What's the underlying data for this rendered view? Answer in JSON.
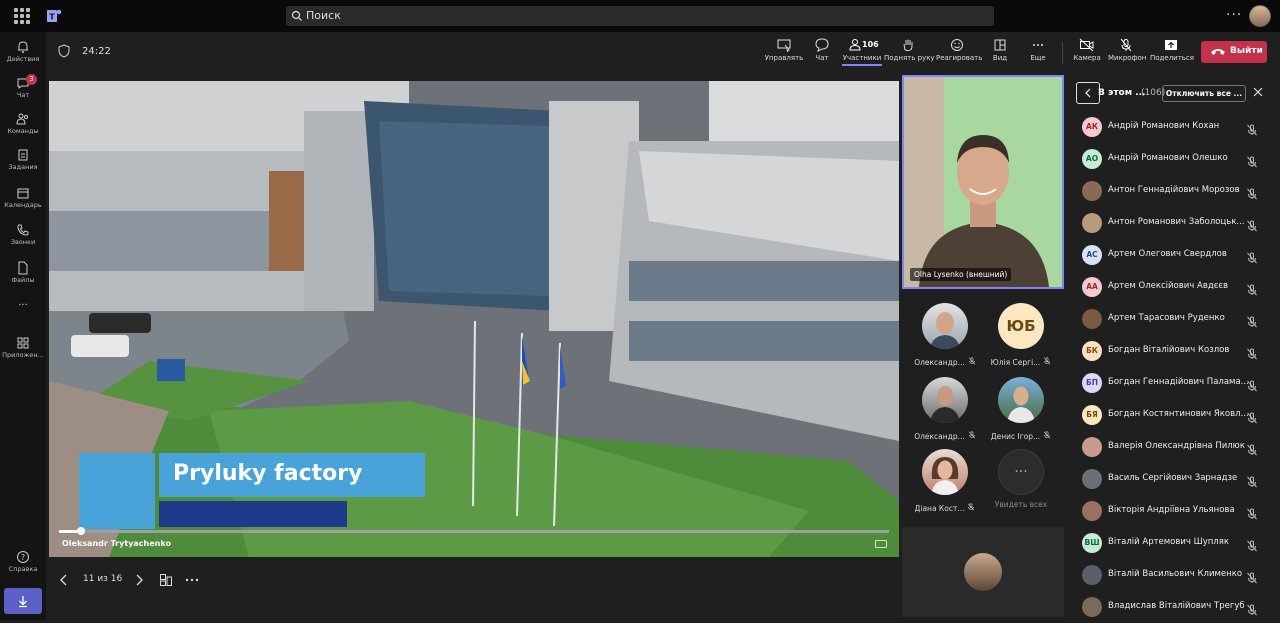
{
  "topbar": {
    "search_placeholder": "Поиск",
    "more": "···"
  },
  "rail": [
    {
      "label": "Действия",
      "icon": "bell-icon"
    },
    {
      "label": "Чат",
      "icon": "chat-icon",
      "badge": "3"
    },
    {
      "label": "Команды",
      "icon": "teams-icon"
    },
    {
      "label": "Задания",
      "icon": "assignments-icon"
    },
    {
      "label": "Календарь",
      "icon": "calendar-icon"
    },
    {
      "label": "Звонки",
      "icon": "phone-icon"
    },
    {
      "label": "Файлы",
      "icon": "file-icon"
    },
    {
      "label": "···",
      "icon": "more-icon"
    },
    {
      "label": "Приложен...",
      "icon": "apps-icon"
    },
    {
      "label": "Справка",
      "icon": "help-icon"
    }
  ],
  "meeting": {
    "timer": "24:22",
    "controls": [
      {
        "label": "Управлять",
        "icon": "share-control-icon"
      },
      {
        "label": "Чат",
        "icon": "chat-icon"
      },
      {
        "label": "Участники",
        "icon": "people-icon",
        "count": "106",
        "active": true
      },
      {
        "label": "Поднять руку",
        "icon": "hand-icon"
      },
      {
        "label": "Реагировать",
        "icon": "smile-icon"
      },
      {
        "label": "Вид",
        "icon": "layout-icon"
      },
      {
        "label": "Еще",
        "icon": "more-icon"
      },
      {
        "label": "Камера",
        "icon": "camera-off-icon"
      },
      {
        "label": "Микрофон",
        "icon": "mic-off-icon"
      },
      {
        "label": "Поделиться",
        "icon": "share-icon"
      }
    ],
    "leave_label": "Выйти"
  },
  "stage": {
    "caption_title": "Pryluky factory",
    "presenter_name": "Oleksandr Trytyachenko",
    "progress_fraction": 0.026,
    "slide_counter": "11 из 16"
  },
  "speaker": {
    "name": "Olha Lysenko (внешний)"
  },
  "tiles": [
    {
      "name": "Олександр...",
      "type": "photo",
      "muted": true
    },
    {
      "name": "Юлія Сергі...",
      "type": "initials",
      "initials": "ЮБ",
      "muted": true
    },
    {
      "name": "Олександр...",
      "type": "photo",
      "muted": true
    },
    {
      "name": "Денис Ігор...",
      "type": "photo",
      "muted": true
    },
    {
      "name": "Діана Кост...",
      "type": "photo",
      "muted": true
    },
    {
      "name": "Увидеть всех",
      "type": "more",
      "muted": false
    }
  ],
  "panel": {
    "title": "В этом ...",
    "count": "(106)",
    "mute_all_label": "Отключить все ...",
    "participants": [
      {
        "name": "Андрій Романович Кохан",
        "initials": "АК",
        "bg": "#f4c9d0",
        "fg": "#a4262c"
      },
      {
        "name": "Андрій Романович Олешко",
        "initials": "АО",
        "bg": "#c7ead4",
        "fg": "#0b6a3b"
      },
      {
        "name": "Антон Геннадійович Морозов",
        "initials": "",
        "bg": "#8a6a55",
        "fg": "#fff"
      },
      {
        "name": "Антон Романович Заболоцьк...",
        "initials": "",
        "bg": "#b79a7a",
        "fg": "#fff"
      },
      {
        "name": "Артем Олегович Свердлов",
        "initials": "АС",
        "bg": "#d7e3f0",
        "fg": "#2c4a7a"
      },
      {
        "name": "Артем Олексійович Авдєєв",
        "initials": "АА",
        "bg": "#f4c9d0",
        "fg": "#a4262c"
      },
      {
        "name": "Артем Тарасович Руденко",
        "initials": "",
        "bg": "#7a5a40",
        "fg": "#fff"
      },
      {
        "name": "Богдан Віталійович Козлов",
        "initials": "БК",
        "bg": "#fde2c4",
        "fg": "#8a4b08"
      },
      {
        "name": "Богдан Геннадійович Палама...",
        "initials": "БП",
        "bg": "#dcd6f7",
        "fg": "#4b3fa0"
      },
      {
        "name": "Богдан Костянтинович Яковл...",
        "initials": "БЯ",
        "bg": "#fce7c1",
        "fg": "#6a4a10"
      },
      {
        "name": "Валерія Олександрівна Пилюк",
        "initials": "",
        "bg": "#c89a90",
        "fg": "#fff"
      },
      {
        "name": "Василь Сергійович Зарнадзе",
        "initials": "",
        "bg": "#6a6f78",
        "fg": "#fff"
      },
      {
        "name": "Вікторія Андріївна Ульянова",
        "initials": "",
        "bg": "#9a7060",
        "fg": "#fff"
      },
      {
        "name": "Віталій Артемович Шупляк",
        "initials": "ВШ",
        "bg": "#c7ead4",
        "fg": "#0b6a3b"
      },
      {
        "name": "Віталій Васильович Клименко",
        "initials": "",
        "bg": "#5a5f6a",
        "fg": "#fff"
      },
      {
        "name": "Владислав Віталійович Трегуб",
        "initials": "",
        "bg": "#7a6a5a",
        "fg": "#fff"
      }
    ]
  }
}
